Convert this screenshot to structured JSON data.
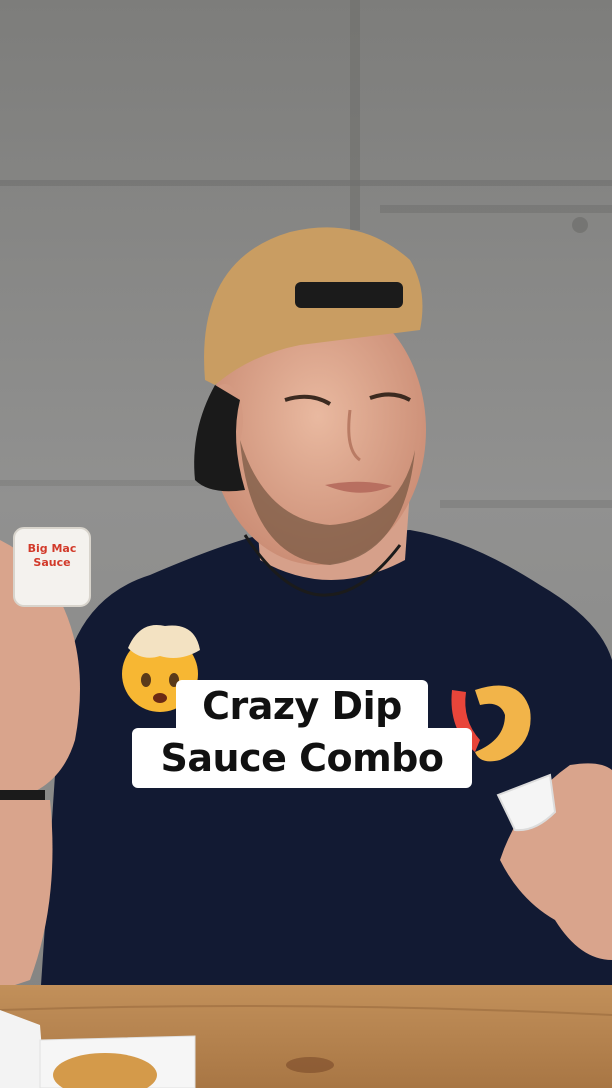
{
  "caption": {
    "line1": "Crazy Dip",
    "line2": "Sauce Combo"
  },
  "props": {
    "sauce_packet_label": "Big Mac Sauce"
  },
  "stickers": {
    "left": "exploding-head-emoji",
    "right": "shrimp-emoji"
  },
  "colors": {
    "wall": "#8a8a88",
    "shirt": "#111a33",
    "table": "#b7844e",
    "cap": "#c99d62",
    "caption_bg": "#ffffff"
  }
}
